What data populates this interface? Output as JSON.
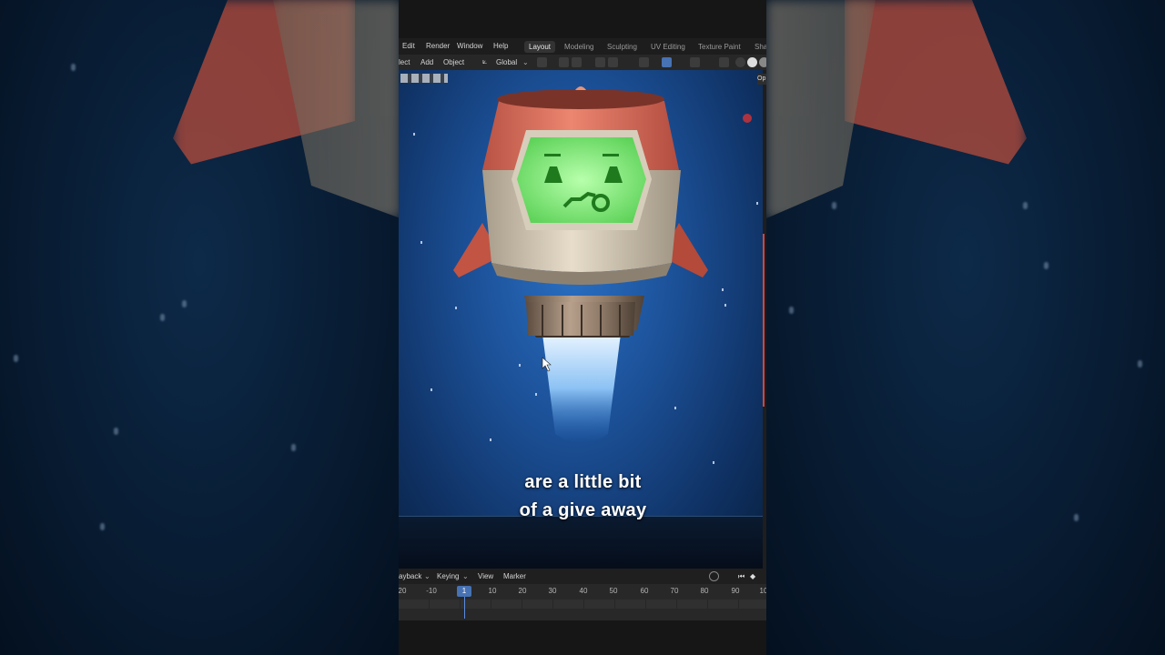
{
  "menubar": {
    "items": [
      "Edit",
      "Render",
      "Window",
      "Help"
    ],
    "workspaces": [
      "Layout",
      "Modeling",
      "Sculpting",
      "UV Editing",
      "Texture Paint",
      "Sha"
    ],
    "active_workspace": "Layout"
  },
  "toolbar": {
    "select_label": "lect",
    "add_label": "Add",
    "object_label": "Object",
    "transform_orientation": "Global"
  },
  "viewport": {
    "options_label": "Op"
  },
  "subtitle": {
    "line1": "are a little bit",
    "line2": "of a give away"
  },
  "timeline": {
    "menu": [
      "ayback",
      "Keying",
      "View",
      "Marker"
    ],
    "current_frame": "1",
    "ticks": [
      "20",
      "-10",
      "10",
      "20",
      "30",
      "40",
      "50",
      "60",
      "70",
      "80",
      "90",
      "10"
    ]
  },
  "colors": {
    "accent": "#4772b3",
    "rocket_body": "#d9cdb8",
    "rocket_top": "#d96e5a",
    "screen_green": "#8ff08a",
    "space_blue": "#1b4f95"
  }
}
